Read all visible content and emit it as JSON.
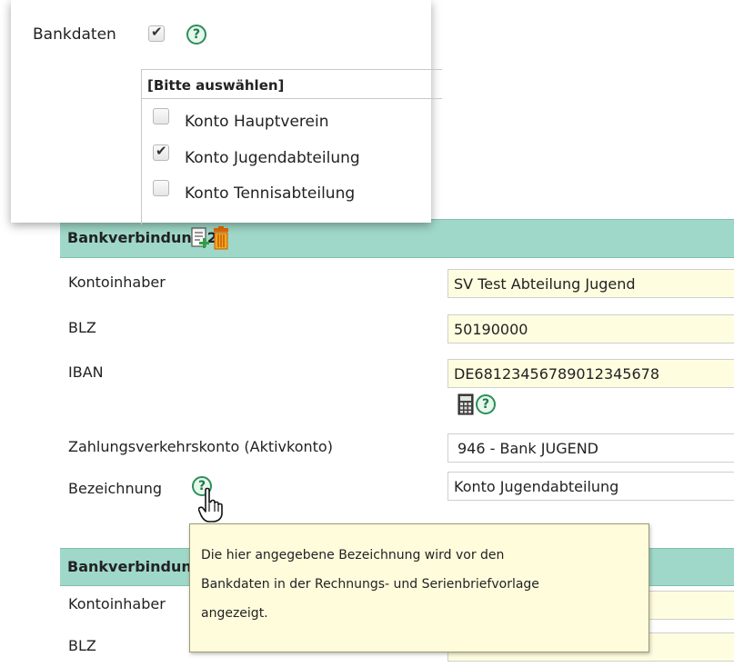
{
  "top_panel": {
    "bankdaten_label": "Bankdaten",
    "bankdaten_checked": true,
    "help_glyph": "?",
    "select_header": "[Bitte auswählen]",
    "options": [
      {
        "label": "Konto Hauptverein",
        "checked": false
      },
      {
        "label": "Konto Jugendabteilung",
        "checked": true
      },
      {
        "label": "Konto Tennisabteilung",
        "checked": false
      }
    ]
  },
  "section1": {
    "title": "Bankverbindung 2",
    "icons": [
      "document-add-icon",
      "trash-icon"
    ],
    "fields": [
      {
        "label": "Kontoinhaber",
        "value": "SV Test Abteilung Jugend"
      },
      {
        "label": "BLZ",
        "value": "50190000"
      },
      {
        "label": "IBAN",
        "value": "DE68123456789012345678"
      },
      {
        "label": "Zahlungsverkehrskonto (Aktivkonto)",
        "value": "946 - Bank JUGEND"
      },
      {
        "label": "Bezeichnung",
        "value": "Konto Jugendabteilung"
      }
    ]
  },
  "section2": {
    "title": "Bankverbindung",
    "fields": [
      {
        "label": "Kontoinhaber"
      },
      {
        "label": "BLZ"
      }
    ]
  },
  "tooltip": {
    "lines": [
      "Die hier angegebene Bezeichnung wird vor den",
      "Bankdaten in der Rechnungs- und Serienbriefvorlage",
      "angezeigt."
    ]
  },
  "colors": {
    "header_bg": "#9fd8c8",
    "input_bg": "#fffde0",
    "help_green": "#2b8f5a",
    "tooltip_bg": "#fffcdc"
  }
}
